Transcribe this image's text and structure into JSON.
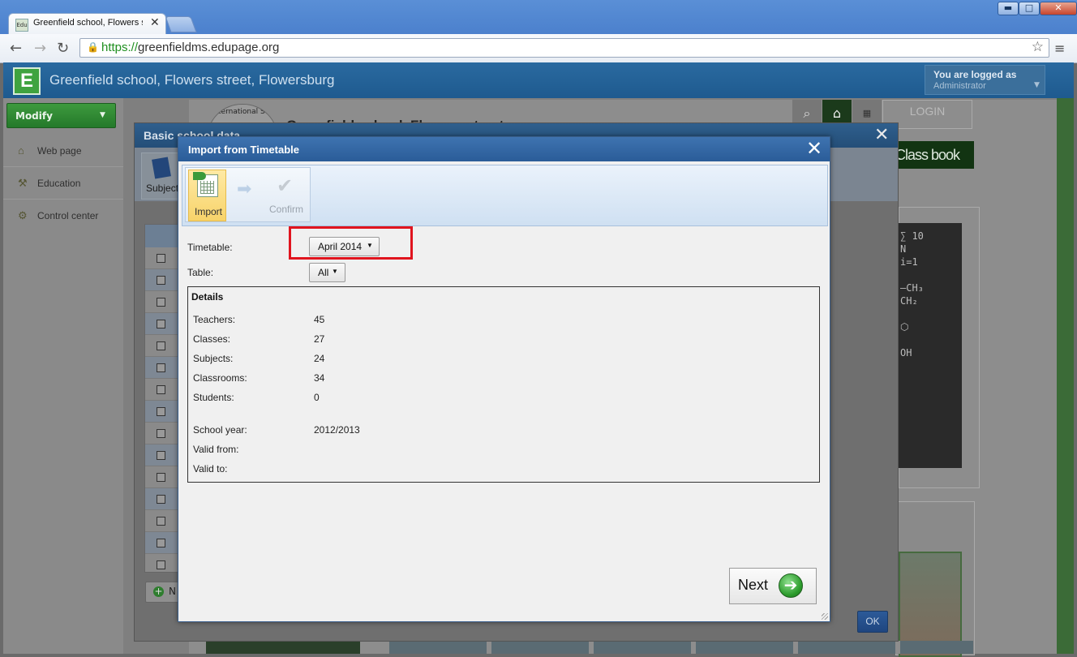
{
  "browser": {
    "tab_title": "Greenfield school, Flowers st",
    "tab_favicon": "Edu",
    "url_scheme": "https://",
    "url_host": "greenfieldms.edupage.org",
    "window_buttons": {
      "minimize": "▬",
      "maximize": "□",
      "close": "✕"
    }
  },
  "site": {
    "title": "Greenfield school, Flowers street, Flowersburg",
    "logo_letter": "E",
    "logged_line1": "You are logged as",
    "logged_line2": "Administrator"
  },
  "sidebar": {
    "modify_label": "Modify",
    "items": [
      {
        "label": "Web page",
        "icon": "house-icon"
      },
      {
        "label": "Education",
        "icon": "desk-icon"
      },
      {
        "label": "Control center",
        "icon": "gear-icon"
      }
    ]
  },
  "background_page": {
    "school_name": "Greenfield school, Flowers street",
    "emblem_text": "International Sch",
    "login_label": "LOGIN",
    "classbook_label": "Class book",
    "board_text": "∑ 10\nN\ni=1\n\n–CH₃\nCH₂\n\n⬡\n\nOH"
  },
  "basic_school_data": {
    "title": "Basic school data",
    "subject_button": "Subject",
    "new_button": "N",
    "ok_button": "OK"
  },
  "import_dialog": {
    "title": "Import from Timetable",
    "steps": [
      {
        "label": "Import",
        "state": "active"
      },
      {
        "label": "Confirm",
        "state": "disabled"
      }
    ],
    "timetable_label": "Timetable:",
    "timetable_value": "April 2014",
    "table_label": "Table:",
    "table_value": "All",
    "details": {
      "title": "Details",
      "rows": [
        {
          "label": "Teachers:",
          "value": "45"
        },
        {
          "label": "Classes:",
          "value": "27"
        },
        {
          "label": "Subjects:",
          "value": "24"
        },
        {
          "label": "Classrooms:",
          "value": "34"
        },
        {
          "label": "Students:",
          "value": "0"
        },
        {
          "label": "School year:",
          "value": "2012/2013"
        },
        {
          "label": "Valid from:",
          "value": ""
        },
        {
          "label": "Valid to:",
          "value": ""
        }
      ]
    },
    "next_label": "Next"
  },
  "colors": {
    "highlight_box": "#e0141e",
    "dialog_header": "#2a5c98",
    "modify_button": "#24792a"
  }
}
